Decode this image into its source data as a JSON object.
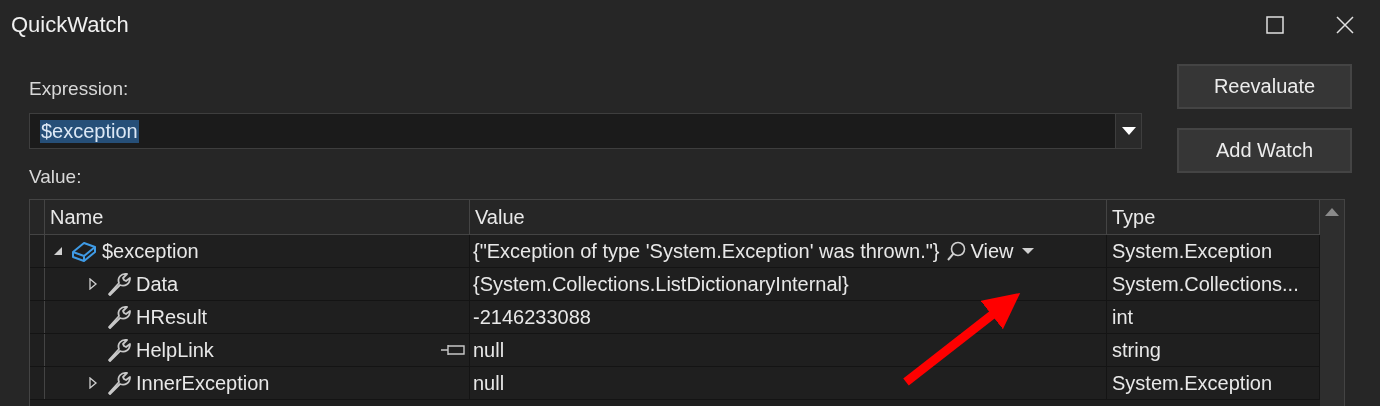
{
  "window": {
    "title": "QuickWatch"
  },
  "expression": {
    "label": "Expression:",
    "value": "$exception",
    "text_selected": true
  },
  "buttons": [
    {
      "label": "Reevaluate"
    },
    {
      "label": "Add Watch"
    }
  ],
  "value_label": "Value:",
  "table": {
    "columns": [
      "Name",
      "Value",
      "Type"
    ],
    "rows": [
      {
        "name": "$exception",
        "kind": "object",
        "value": "{\"Exception of type 'System.Exception' was thrown.\"}",
        "view_label": "View",
        "type": "System.Exception",
        "expanded": true,
        "children": [
          {
            "name": "Data",
            "kind": "property",
            "value": "{System.Collections.ListDictionaryInternal}",
            "type": "System.Collections...",
            "expanded": false
          },
          {
            "name": "HResult",
            "kind": "property",
            "value": "-2146233088",
            "type": "int"
          },
          {
            "name": "HelpLink",
            "kind": "property",
            "value": "null",
            "type": "string",
            "pinnable": true
          },
          {
            "name": "InnerException",
            "kind": "property",
            "value": "null",
            "type": "System.Exception",
            "expanded": false
          }
        ]
      }
    ]
  }
}
